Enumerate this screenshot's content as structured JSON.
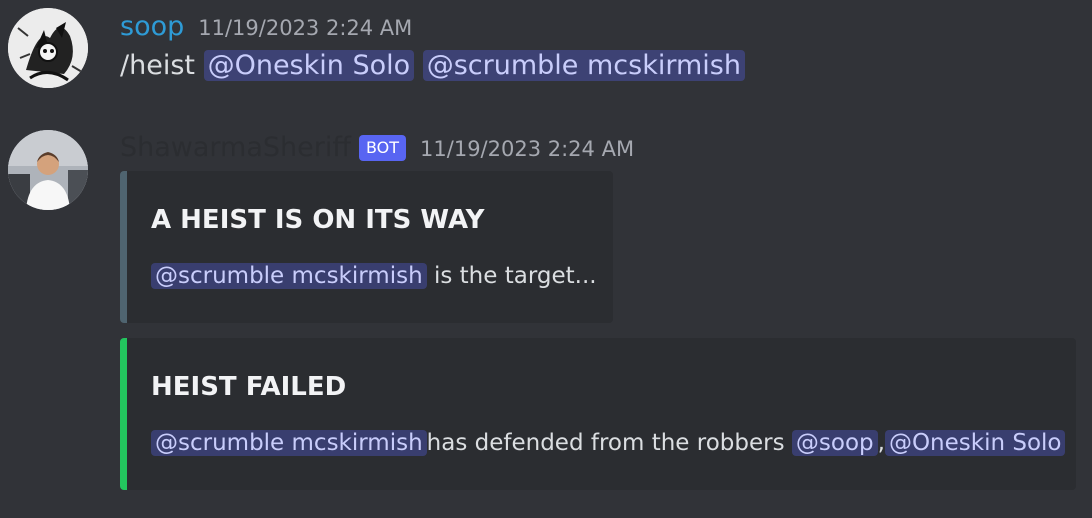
{
  "messages": [
    {
      "username": "soop",
      "timestamp": "11/19/2023 2:24 AM",
      "command": "/heist",
      "mentions": [
        "@Oneskin Solo",
        "@scrumble mcskirmish"
      ]
    },
    {
      "username": "ShawarmaSheriff",
      "bot_tag": "BOT",
      "timestamp": "11/19/2023 2:24 AM",
      "embeds": [
        {
          "title": "A HEIST IS ON ITS WAY",
          "mention": "@scrumble mcskirmish",
          "text": "is the target..."
        },
        {
          "title": "HEIST FAILED",
          "mention": "@scrumble mcskirmish",
          "text": "has defended from the robbers",
          "mention2": "@soop",
          "separator": ",",
          "mention3": "@Oneskin Solo"
        }
      ]
    }
  ]
}
